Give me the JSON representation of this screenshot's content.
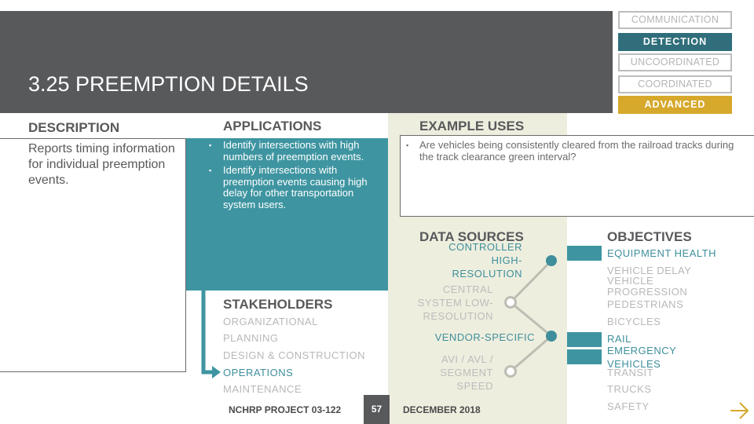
{
  "header": {
    "title": "3.25 PREEMPTION DETAILS"
  },
  "category_tags": [
    {
      "label": "COMMUNICATION",
      "state": "inactive"
    },
    {
      "label": "DETECTION",
      "state": "active",
      "color": "#2f6e7a"
    },
    {
      "label": "UNCOORDINATED",
      "state": "inactive"
    },
    {
      "label": "COORDINATED",
      "state": "inactive"
    },
    {
      "label": "ADVANCED",
      "state": "active",
      "color": "#d6a82b"
    }
  ],
  "description": {
    "heading": "DESCRIPTION",
    "text": "Reports timing information for individual preemption events."
  },
  "applications": {
    "heading": "APPLICATIONS",
    "items": [
      "Identify intersections with high numbers of preemption events.",
      "Identify intersections with preemption events causing high delay for other transportation system users."
    ]
  },
  "example_uses": {
    "heading": "EXAMPLE USES",
    "items": [
      "Are vehicles being consistently cleared from the railroad tracks during the track clearance green interval?"
    ]
  },
  "stakeholders": {
    "heading": "STAKEHOLDERS",
    "items": [
      {
        "label": "ORGANIZATIONAL",
        "active": false
      },
      {
        "label": "PLANNING",
        "active": false
      },
      {
        "label": "DESIGN & CONSTRUCTION",
        "active": false
      },
      {
        "label": "OPERATIONS",
        "active": true
      },
      {
        "label": "MAINTENANCE",
        "active": false
      }
    ]
  },
  "data_sources": {
    "heading": "DATA SOURCES",
    "items": [
      {
        "label": "CONTROLLER HIGH-RESOLUTION",
        "active": true
      },
      {
        "label": "CENTRAL SYSTEM LOW-RESOLUTION",
        "active": false
      },
      {
        "label": "VENDOR-SPECIFIC",
        "active": true
      },
      {
        "label": "AVI / AVL / SEGMENT SPEED",
        "active": false
      }
    ]
  },
  "objectives": {
    "heading": "OBJECTIVES",
    "items": [
      {
        "label": "EQUIPMENT HEALTH",
        "active": true
      },
      {
        "label": "VEHICLE DELAY",
        "active": false
      },
      {
        "label": "VEHICLE PROGRESSION",
        "active": false
      },
      {
        "label": "PEDESTRIANS",
        "active": false
      },
      {
        "label": "BICYCLES",
        "active": false
      },
      {
        "label": "RAIL",
        "active": true
      },
      {
        "label": "EMERGENCY VEHICLES",
        "active": true
      },
      {
        "label": "TRANSIT",
        "active": false
      },
      {
        "label": "TRUCKS",
        "active": false
      },
      {
        "label": "SAFETY",
        "active": false
      }
    ]
  },
  "footer": {
    "project": "NCHRP PROJECT 03-122",
    "page_number": "57",
    "date": "DECEMBER 2018"
  },
  "colors": {
    "teal": "#3e95a1",
    "dark_teal": "#2f6e7a",
    "gold": "#d6a82b",
    "header_gray": "#58595b",
    "cream": "#eeeedf"
  }
}
